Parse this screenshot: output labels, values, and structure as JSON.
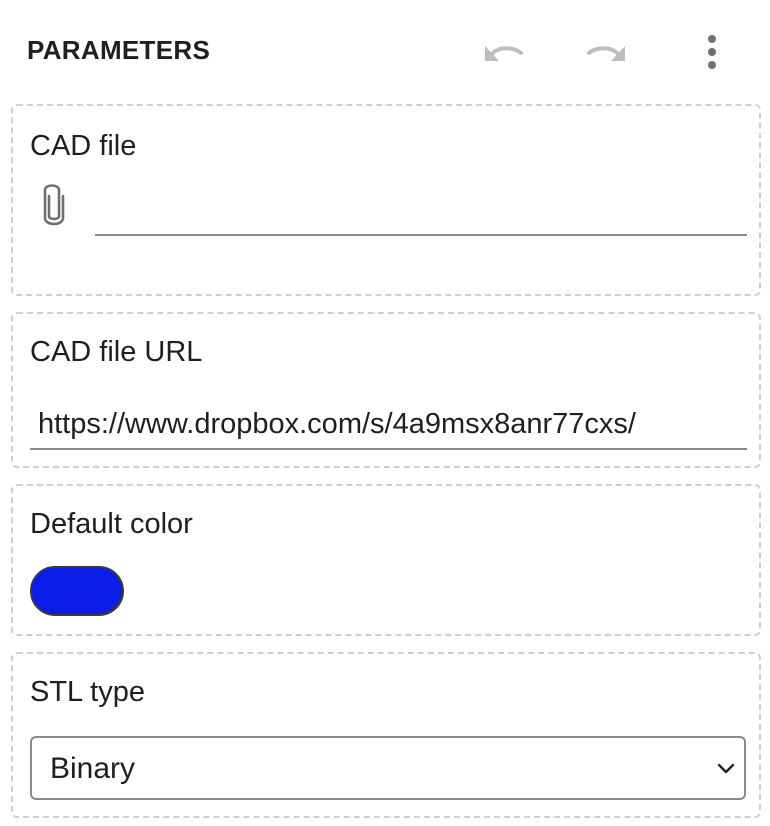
{
  "header": {
    "title": "PARAMETERS",
    "icons": {
      "undo": "undo-icon",
      "redo": "redo-icon",
      "more": "more-vertical-icon"
    }
  },
  "params": {
    "cad_file": {
      "label": "CAD file",
      "icon": "paperclip-icon",
      "value": ""
    },
    "cad_file_url": {
      "label": "CAD file URL",
      "value": "https://www.dropbox.com/s/4a9msx8anr77cxs/"
    },
    "default_color": {
      "label": "Default color",
      "value": "#0c1de8"
    },
    "stl_type": {
      "label": "STL type",
      "selected": "Binary"
    }
  },
  "colors": {
    "icon_disabled": "#bdbdbd",
    "icon_active": "#6f6f6f",
    "border_dashed": "#cfcfcf",
    "underline": "#8a8a8a"
  }
}
